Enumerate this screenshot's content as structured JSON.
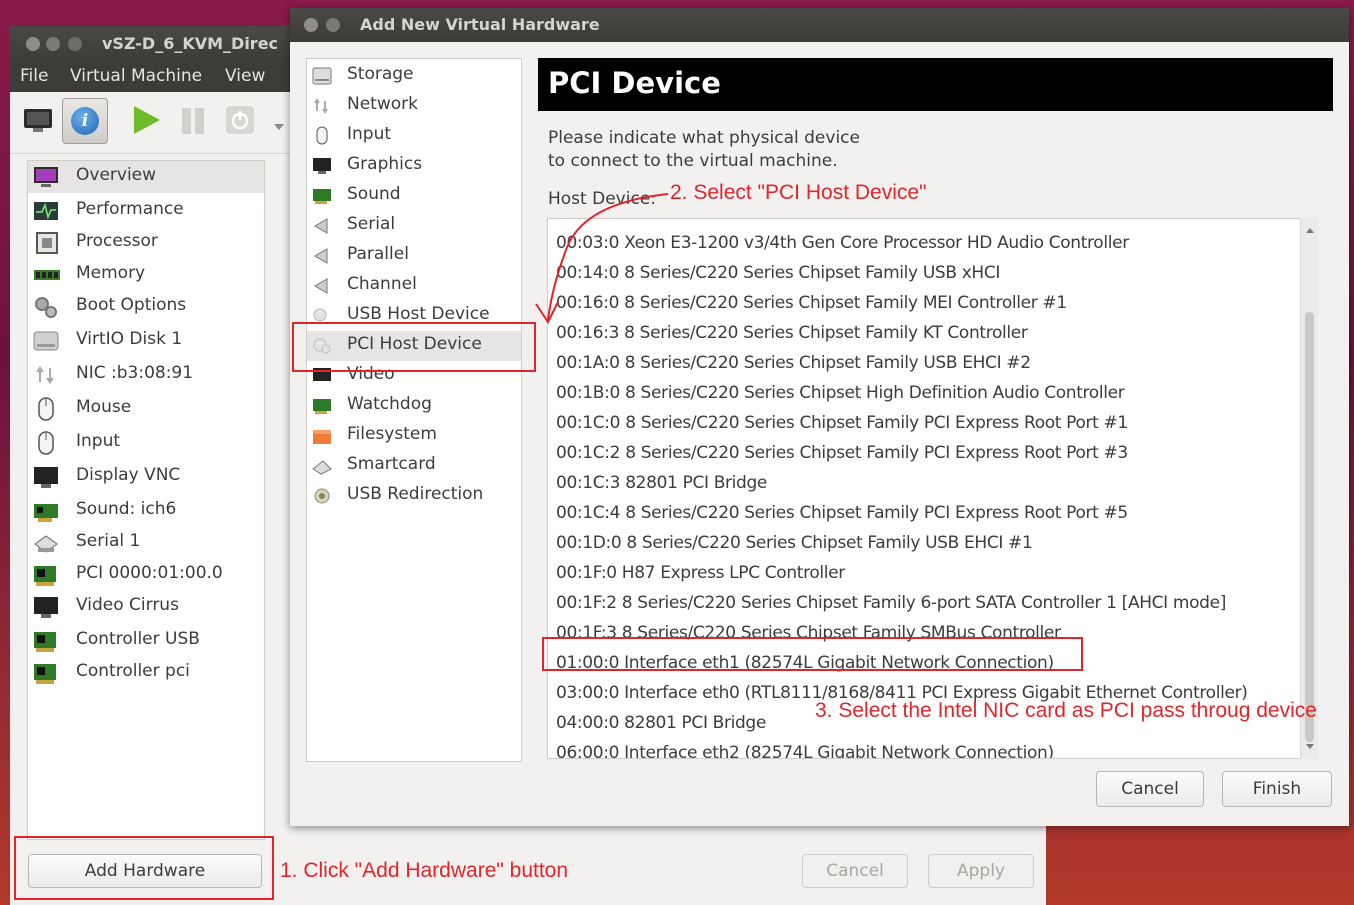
{
  "vm_window": {
    "title": "vSZ-D_6_KVM_Direc",
    "menu": [
      "File",
      "Virtual Machine",
      "View"
    ],
    "hardware_items": [
      {
        "label": "Overview",
        "icon": "monitor-icon"
      },
      {
        "label": "Performance",
        "icon": "performance-icon"
      },
      {
        "label": "Processor",
        "icon": "processor-icon"
      },
      {
        "label": "Memory",
        "icon": "memory-icon"
      },
      {
        "label": "Boot Options",
        "icon": "gears-icon"
      },
      {
        "label": "VirtIO Disk 1",
        "icon": "disk-icon"
      },
      {
        "label": "NIC :b3:08:91",
        "icon": "network-icon"
      },
      {
        "label": "Mouse",
        "icon": "mouse-icon"
      },
      {
        "label": "Input",
        "icon": "input-icon"
      },
      {
        "label": "Display VNC",
        "icon": "display-icon"
      },
      {
        "label": "Sound: ich6",
        "icon": "sound-card-icon"
      },
      {
        "label": "Serial 1",
        "icon": "serial-icon"
      },
      {
        "label": "PCI 0000:01:00.0",
        "icon": "pci-card-icon"
      },
      {
        "label": "Video Cirrus",
        "icon": "video-icon"
      },
      {
        "label": "Controller USB",
        "icon": "controller-icon"
      },
      {
        "label": "Controller pci",
        "icon": "controller-icon"
      }
    ],
    "add_hardware": "Add Hardware",
    "cancel": "Cancel",
    "apply": "Apply"
  },
  "dialog": {
    "title": "Add New Virtual Hardware",
    "categories": [
      {
        "label": "Storage",
        "icon": "storage-icon"
      },
      {
        "label": "Network",
        "icon": "network-icon"
      },
      {
        "label": "Input",
        "icon": "mouse-icon"
      },
      {
        "label": "Graphics",
        "icon": "graphics-icon"
      },
      {
        "label": "Sound",
        "icon": "sound-card-icon"
      },
      {
        "label": "Serial",
        "icon": "serial-icon"
      },
      {
        "label": "Parallel",
        "icon": "parallel-icon"
      },
      {
        "label": "Channel",
        "icon": "channel-icon"
      },
      {
        "label": "USB Host Device",
        "icon": "usb-icon"
      },
      {
        "label": "PCI Host Device",
        "icon": "pci-icon"
      },
      {
        "label": "Video",
        "icon": "video-icon"
      },
      {
        "label": "Watchdog",
        "icon": "watchdog-icon"
      },
      {
        "label": "Filesystem",
        "icon": "folder-icon"
      },
      {
        "label": "Smartcard",
        "icon": "smartcard-icon"
      },
      {
        "label": "USB Redirection",
        "icon": "usb-redirection-icon"
      }
    ],
    "selected_category": "PCI Host Device",
    "header": "PCI Device",
    "instruction_line1": "Please indicate what physical device",
    "instruction_line2": "to connect to the virtual machine.",
    "host_device_label": "Host Device:",
    "devices": [
      "00:03:0 Xeon E3-1200 v3/4th Gen Core Processor HD Audio Controller",
      "00:14:0 8 Series/C220 Series Chipset Family USB xHCI",
      "00:16:0 8 Series/C220 Series Chipset Family MEI Controller #1",
      "00:16:3 8 Series/C220 Series Chipset Family KT Controller",
      "00:1A:0 8 Series/C220 Series Chipset Family USB EHCI #2",
      "00:1B:0 8 Series/C220 Series Chipset High Definition Audio Controller",
      "00:1C:0 8 Series/C220 Series Chipset Family PCI Express Root Port #1",
      "00:1C:2 8 Series/C220 Series Chipset Family PCI Express Root Port #3",
      "00:1C:3 82801 PCI Bridge",
      "00:1C:4 8 Series/C220 Series Chipset Family PCI Express Root Port #5",
      "00:1D:0 8 Series/C220 Series Chipset Family USB EHCI #1",
      "00:1F:0 H87 Express LPC Controller",
      "00:1F:2 8 Series/C220 Series Chipset Family 6-port SATA Controller 1 [AHCI mode]",
      "00:1F:3 8 Series/C220 Series Chipset Family SMBus Controller",
      "01:00:0 Interface eth1 (82574L Gigabit Network Connection)",
      "03:00:0 Interface eth0 (RTL8111/8168/8411 PCI Express Gigabit Ethernet Controller)",
      "04:00:0 82801 PCI Bridge",
      "06:00:0 Interface eth2 (82574L Gigabit Network Connection)"
    ],
    "selected_device": "01:00:0 Interface eth1 (82574L Gigabit Network Connection)",
    "cancel": "Cancel",
    "finish": "Finish"
  },
  "annotations": {
    "step1": "1. Click \"Add Hardware\" button",
    "step2": "2. Select \"PCI Host Device\"",
    "step3": "3. Select the Intel NIC card as PCI pass throug device"
  },
  "colors": {
    "annotation_red": "#e0262b",
    "titlebar": "#3c3b37",
    "window_bg": "#f2f1f0",
    "header_bg": "#000000"
  }
}
